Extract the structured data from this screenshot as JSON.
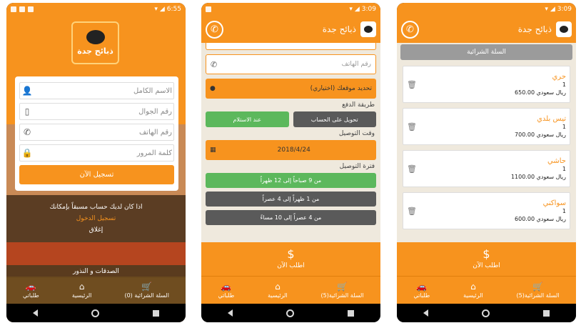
{
  "status": {
    "time1": "6:55",
    "time2": "3:09",
    "time3": "3:09"
  },
  "app": {
    "title": "ذبائح جدة",
    "logo_text": "ذبائح جدة"
  },
  "login": {
    "fields": [
      {
        "placeholder": "الاسم الكامل",
        "icon": "person-icon"
      },
      {
        "placeholder": "رقم الجوال",
        "icon": "mobile-icon"
      },
      {
        "placeholder": "رقم الهاتف",
        "icon": "phone-icon"
      },
      {
        "placeholder": "كلمة المرور",
        "icon": "lock-icon"
      }
    ],
    "register_label": "تسجيل الآن",
    "have_account": "اذا كان لديك حساب مسبقاً بإمكانك",
    "login_link": "تسجيل الدخول",
    "close": "إغلاق",
    "strip_text": "الصدقات و النذور",
    "nav": {
      "account": "طلباتي",
      "home": "الرئيسية",
      "cart": "السلة الشرائية (0)"
    }
  },
  "checkout": {
    "phone_placeholder": "رقم الهاتف",
    "location_label": "تحديد موقعك (اختياري)",
    "payment_title": "طريقة الدفع",
    "pay_transfer": "تحويل على الحساب",
    "pay_cash": "عند الاستلام",
    "delivery_time_title": "وقت التوصيل",
    "date": "2018/4/24",
    "period_title": "فترة التوصيل",
    "slots": [
      "من 9 صباحاً إلى 12 ظهراً",
      "من 1 ظهراً إلى 4 عصراً",
      "من 4 عصراً إلى 10 مساءً"
    ],
    "order_now": "اطلب الآن",
    "nav": {
      "account": "طلباتي",
      "home": "الرئيسية",
      "cart": "السلة الشرائية(5)"
    }
  },
  "cart": {
    "title": "السلة الشرائية",
    "items": [
      {
        "name": "حري",
        "qty": "1",
        "price": "650.00 ريال سعودي"
      },
      {
        "name": "تيس بلدي",
        "qty": "1",
        "price": "700.00 ريال سعودي"
      },
      {
        "name": "حاشي",
        "qty": "1",
        "price": "1100.00 ريال سعودي"
      },
      {
        "name": "سواكني",
        "qty": "1",
        "price": "600.00 ريال سعودي"
      }
    ],
    "order_now": "اطلب الآن",
    "nav": {
      "account": "طلباتي",
      "home": "الرئيسية",
      "cart": "السلة الشرائية(5)"
    }
  }
}
